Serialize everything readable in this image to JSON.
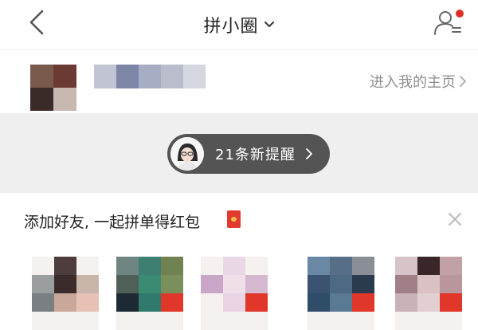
{
  "header": {
    "title": "拼小圈",
    "icons": {
      "back": "chevron-left-icon",
      "dropdown": "chevron-down-icon",
      "user_menu": "user-list-icon"
    },
    "notification_dot_color": "#e02e24"
  },
  "profile": {
    "homepage_link": "进入我的主页",
    "avatar_mosaic": [
      "#7a5a4d",
      "#6b3a32",
      "#3b2b28",
      "#c7b8b2"
    ],
    "name_mosaic": [
      "#c0c4d3",
      "#7d86a6",
      "#a7adc2",
      "#b9bdcc",
      "#d4d6e0"
    ]
  },
  "reminder": {
    "text": "21条新提醒",
    "background": "#545454"
  },
  "friends_suggestion": {
    "title": "添加好友, 一起拼单得红包",
    "icons": {
      "red_packet": "red-packet-icon",
      "close": "close-icon"
    }
  },
  "friend_avatars": [
    [
      "#f4f1ef",
      "#4d3d3d",
      "#f4f1ef",
      "#9a9e9f",
      "#3b2c2b",
      "#c8b4a8",
      "#7a7f84",
      "#c9a79a",
      "#e8c1b6",
      "#f4f1ef",
      "#f4f1ef",
      "#f4f1ef"
    ],
    [
      "#6e8581",
      "#3f7f72",
      "#708152",
      "#4f6058",
      "#3b8a72",
      "#7a8f5c",
      "#1d2a34",
      "#2f7a6b",
      "#e0372a",
      "#f4f1ef",
      "#f4f1ef",
      "#f4f1ef"
    ],
    [
      "#f4f1ef",
      "#ead7e6",
      "#f4f1ef",
      "#c9a6c8",
      "#f0dfe9",
      "#d5b8cf",
      "#f4f1ef",
      "#e9d4e3",
      "#e0372a",
      "#f4f1ef",
      "#f4f1ef",
      "#f4f1ef"
    ],
    [
      "#6a87a3",
      "#566e86",
      "#8a8f97",
      "#3a5370",
      "#4d6a85",
      "#2b3a4c",
      "#2f4d68",
      "#5a7a94",
      "#e0372a",
      "#f4f1ef",
      "#f4f1ef",
      "#f4f1ef"
    ],
    [
      "#d8c4c8",
      "#3a2628",
      "#c2a1a6",
      "#a08086",
      "#d9c1c4",
      "#b9959c",
      "#c9b2b6",
      "#e2cfd1",
      "#e0372a",
      "#f4f1ef",
      "#f4f1ef",
      "#f4f1ef"
    ]
  ]
}
